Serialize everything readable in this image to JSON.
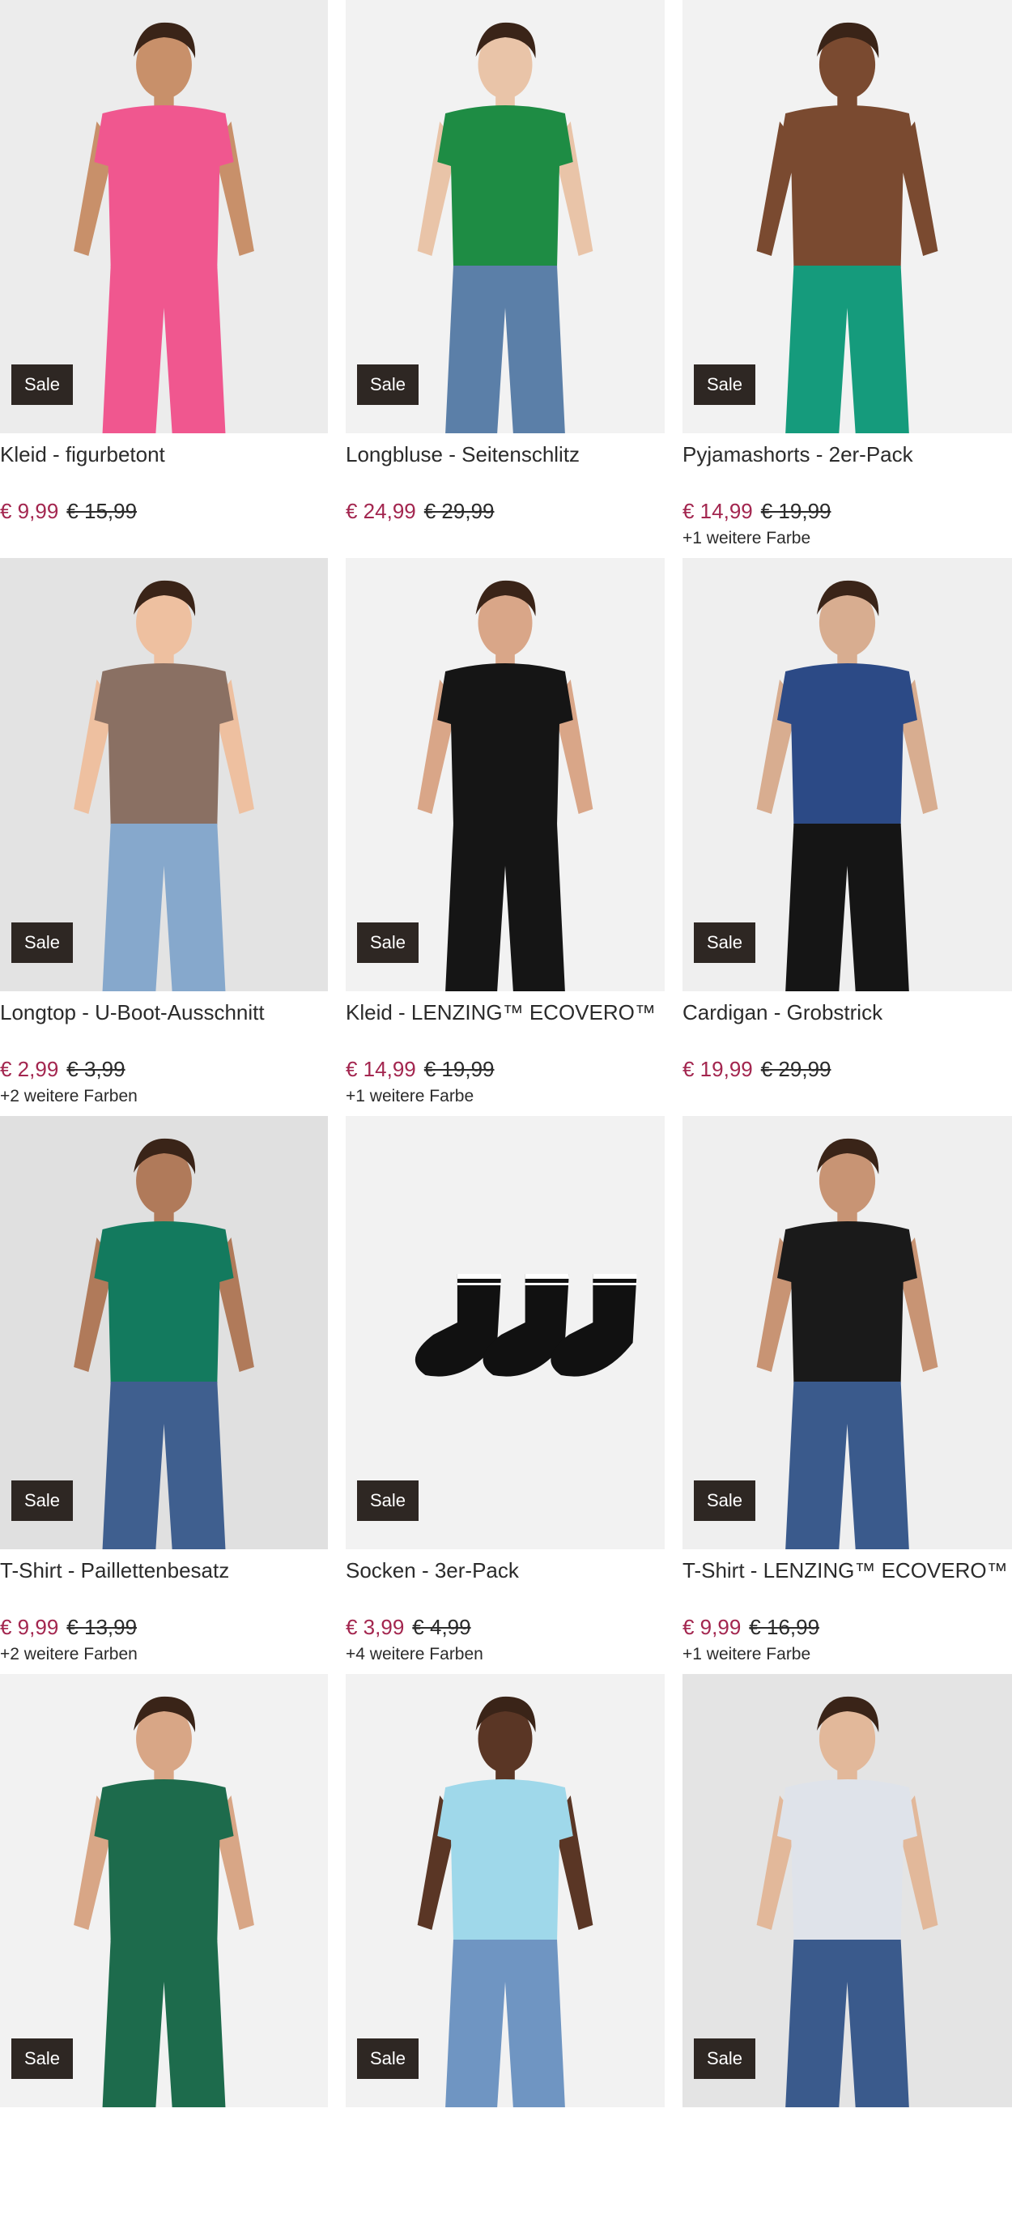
{
  "badge_label": "Sale",
  "colors": {
    "price_sale": "#a3264f",
    "badge_bg": "#2e2723",
    "image_bg": "#efefef"
  },
  "products": [
    {
      "title": "Kleid - figurbetont",
      "price_new": "€ 9,99",
      "price_old": "€ 15,99",
      "more_colors": "",
      "image": {
        "skin": "#c8906a",
        "top": "#f0578f",
        "bottom": "#f0578f",
        "bg": "#ececec"
      }
    },
    {
      "title": "Longbluse - Seitenschlitz",
      "price_new": "€ 24,99",
      "price_old": "€ 29,99",
      "more_colors": "",
      "image": {
        "skin": "#e9c4a8",
        "top": "#1e8c44",
        "bottom": "#5b7fa8",
        "bg": "#f2f2f2"
      }
    },
    {
      "title": "Pyjamashorts - 2er-Pack",
      "price_new": "€ 14,99",
      "price_old": "€ 19,99",
      "more_colors": "+1 weitere Farbe",
      "image": {
        "skin": "#7a4a30",
        "top": "#7a4a30",
        "bottom": "#159b7c",
        "bg": "#f2f2f2"
      }
    },
    {
      "title": "Longtop - U-Boot-Ausschnitt",
      "price_new": "€ 2,99",
      "price_old": "€ 3,99",
      "more_colors": "+2 weitere Farben",
      "image": {
        "skin": "#eec0a0",
        "top": "#8a7063",
        "bottom": "#86a8cc",
        "bg": "#e3e3e3"
      }
    },
    {
      "title": "Kleid - LENZING™ ECOVERO™",
      "price_new": "€ 14,99",
      "price_old": "€ 19,99",
      "more_colors": "+1 weitere Farbe",
      "image": {
        "skin": "#d9a688",
        "top": "#151515",
        "bottom": "#151515",
        "bg": "#f2f2f2"
      }
    },
    {
      "title": "Cardigan - Grobstrick",
      "price_new": "€ 19,99",
      "price_old": "€ 29,99",
      "more_colors": "",
      "image": {
        "skin": "#d8ad90",
        "top": "#2c4a86",
        "bottom": "#151515",
        "bg": "#efefef"
      }
    },
    {
      "title": "T-Shirt - Paillettenbesatz",
      "price_new": "€ 9,99",
      "price_old": "€ 13,99",
      "more_colors": "+2 weitere Farben",
      "image": {
        "skin": "#b07a5a",
        "top": "#137a5e",
        "bottom": "#3f5f8f",
        "bg": "#e0e0e0"
      }
    },
    {
      "title": "Socken - 3er-Pack",
      "price_new": "€ 3,99",
      "price_old": "€ 4,99",
      "more_colors": "+4 weitere Farben",
      "image": {
        "skin": "#111111",
        "top": "#111111",
        "bottom": "#111111",
        "bg": "#f2f2f2"
      }
    },
    {
      "title": "T-Shirt - LENZING™ ECOVERO™",
      "price_new": "€ 9,99",
      "price_old": "€ 16,99",
      "more_colors": "+1 weitere Farbe",
      "image": {
        "skin": "#c89474",
        "top": "#1a1a1a",
        "bottom": "#3a5a8c",
        "bg": "#efefef"
      }
    },
    {
      "title": "",
      "price_new": "",
      "price_old": "",
      "more_colors": "",
      "image": {
        "skin": "#d8a686",
        "top": "#1d6b4c",
        "bottom": "#1d6b4c",
        "bg": "#f2f2f2"
      }
    },
    {
      "title": "",
      "price_new": "",
      "price_old": "",
      "more_colors": "",
      "image": {
        "skin": "#5a3625",
        "top": "#9fd8ea",
        "bottom": "#6f95c2",
        "bg": "#f2f2f2"
      }
    },
    {
      "title": "",
      "price_new": "",
      "price_old": "",
      "more_colors": "",
      "image": {
        "skin": "#e2b89a",
        "top": "#dfe3ea",
        "bottom": "#3a5a8c",
        "bg": "#e4e4e4"
      }
    }
  ]
}
